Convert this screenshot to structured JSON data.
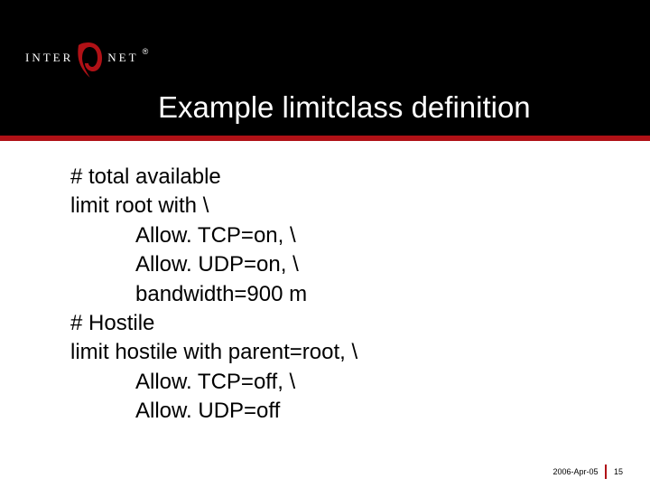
{
  "logo": {
    "left": "INTER",
    "right": "NET",
    "reg": "®"
  },
  "title": "Example limitclass definition",
  "body": {
    "l0": "# total available",
    "l1": "limit root with \\",
    "l2": "Allow. TCP=on, \\",
    "l3": "Allow. UDP=on, \\",
    "l4": "bandwidth=900 m",
    "l5": "# Hostile",
    "l6": "limit hostile with parent=root, \\",
    "l7": "Allow. TCP=off, \\",
    "l8": "Allow. UDP=off"
  },
  "footer": {
    "date": "2006-Apr-05",
    "page": "15"
  }
}
